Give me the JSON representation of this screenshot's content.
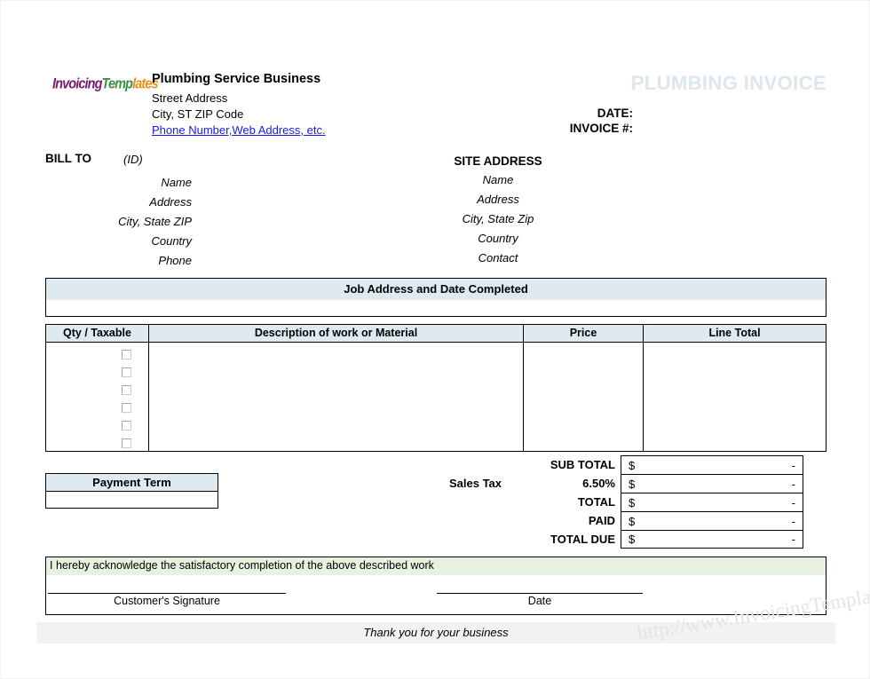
{
  "header": {
    "logo_parts": [
      {
        "text": "Invoicing",
        "color": "#7a1a6e"
      },
      {
        "text": "Temp",
        "color": "#3f8f3f"
      },
      {
        "text": "lates",
        "color": "#e8901c"
      }
    ],
    "company_name": "Plumbing Service Business",
    "company_street": "Street Address",
    "company_city": "City, ST  ZIP Code",
    "company_web": "Phone Number,Web Address, etc.",
    "doc_title": "PLUMBING INVOICE",
    "date_label": "DATE:",
    "invoice_no_label": "INVOICE #:"
  },
  "bill_to": {
    "title": "BILL TO",
    "id": "(ID)",
    "lines": [
      "Name",
      "Address",
      "City,  State ZIP",
      "Country",
      "Phone"
    ]
  },
  "site_address": {
    "title": "SITE ADDRESS",
    "lines": [
      "Name",
      "Address",
      "City,  State Zip",
      "Country",
      "Contact"
    ]
  },
  "job": {
    "title": "Job Address and Date Completed",
    "value": ""
  },
  "items": {
    "columns": [
      "Qty / Taxable",
      "Description of work or Material",
      "Price",
      "Line Total"
    ],
    "checkbox_count": 6,
    "rows": []
  },
  "payment_term": {
    "title": "Payment Term",
    "value": ""
  },
  "totals": {
    "sales_tax_note": "Sales Tax",
    "rows": [
      {
        "label": "SUB TOTAL",
        "currency": "$",
        "value": "-"
      },
      {
        "label": "6.50%",
        "currency": "$",
        "value": "-"
      },
      {
        "label": "TOTAL",
        "currency": "$",
        "value": "-"
      },
      {
        "label": "PAID",
        "currency": "$",
        "value": "-"
      },
      {
        "label": "TOTAL DUE",
        "currency": "$",
        "value": "-"
      }
    ]
  },
  "acknowledgement": {
    "text": "I hereby acknowledge the satisfactory completion of the above described work",
    "signature_label": "Customer's Signature",
    "date_label": "Date"
  },
  "footer": {
    "thanks": "Thank you for your business",
    "watermark": "http://www.InvoicingTemplate.com"
  },
  "colors": {
    "band_blue": "#dfeaf0",
    "band_green": "#e9f2e0",
    "footer_gray": "#f2f2f2",
    "watermark_title": "#dde6ee",
    "link": "#1a1ae6"
  }
}
